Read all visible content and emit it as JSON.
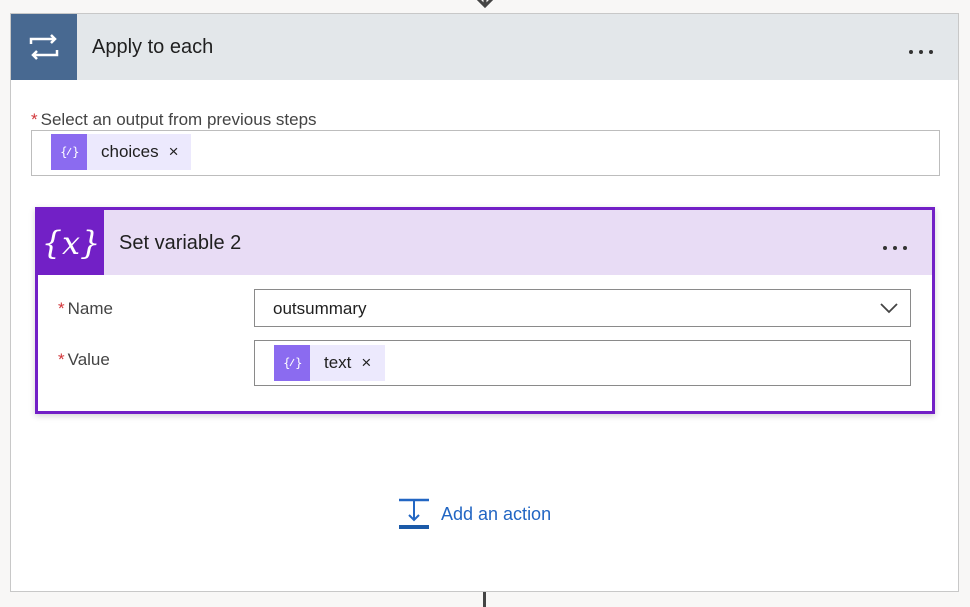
{
  "outer": {
    "title": "Apply to each",
    "output_label": "Select an output from previous steps",
    "token": {
      "text": "choices",
      "remove": "×",
      "icon": "{⁄}"
    }
  },
  "inner": {
    "title": "Set variable 2",
    "icon_text": "{x}",
    "name_label": "Name",
    "name_value": "outsummary",
    "value_label": "Value",
    "value_token": {
      "text": "text",
      "remove": "×",
      "icon": "{⁄}"
    }
  },
  "add_action_label": "Add an action",
  "required_mark": "*",
  "colors": {
    "loop_header": "#486991",
    "variable_accent": "#7220c6",
    "token_icon": "#8b6bf0",
    "link": "#2266c3"
  },
  "icons": {
    "loop": "loop-arrows-icon",
    "variable": "variable-x-icon",
    "expression": "expression-icon",
    "add_action": "add-action-icon",
    "dropdown": "chevron-down-icon",
    "more": "more-options-icon"
  }
}
